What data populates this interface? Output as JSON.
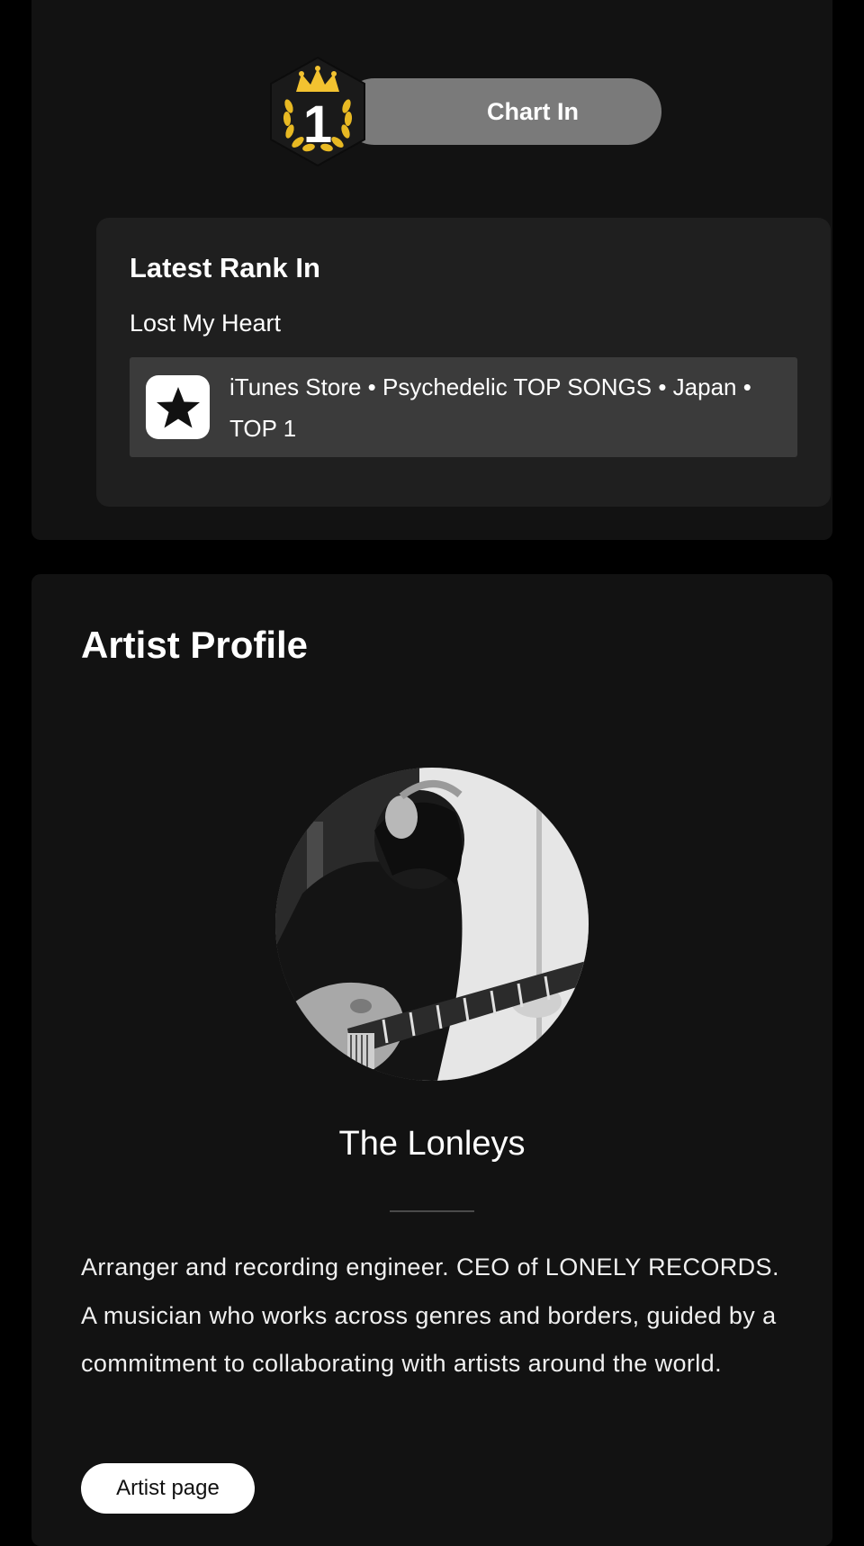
{
  "chart_badge": {
    "rank_number": "1",
    "label": "Chart In"
  },
  "latest_rank": {
    "heading": "Latest Rank In",
    "song_title": "Lost My Heart",
    "entry": {
      "icon": "star-icon",
      "text": "iTunes Store • Psychedelic TOP SONGS • Japan • TOP 1"
    }
  },
  "artist_profile": {
    "heading": "Artist Profile",
    "name": "The Lonleys",
    "bio": "Arranger and recording engineer. CEO of LONELY RECORDS. A musician who works across genres and borders, guided by a commitment to collaborating with artists around the world.",
    "button_label": "Artist page"
  },
  "colors": {
    "page_bg": "#000000",
    "card_bg": "#121212",
    "inner_card_bg": "#1f1f1f",
    "entry_bg": "#3b3b3b",
    "pill_bg": "#7a7a7a",
    "badge_gold": "#f2c230"
  }
}
